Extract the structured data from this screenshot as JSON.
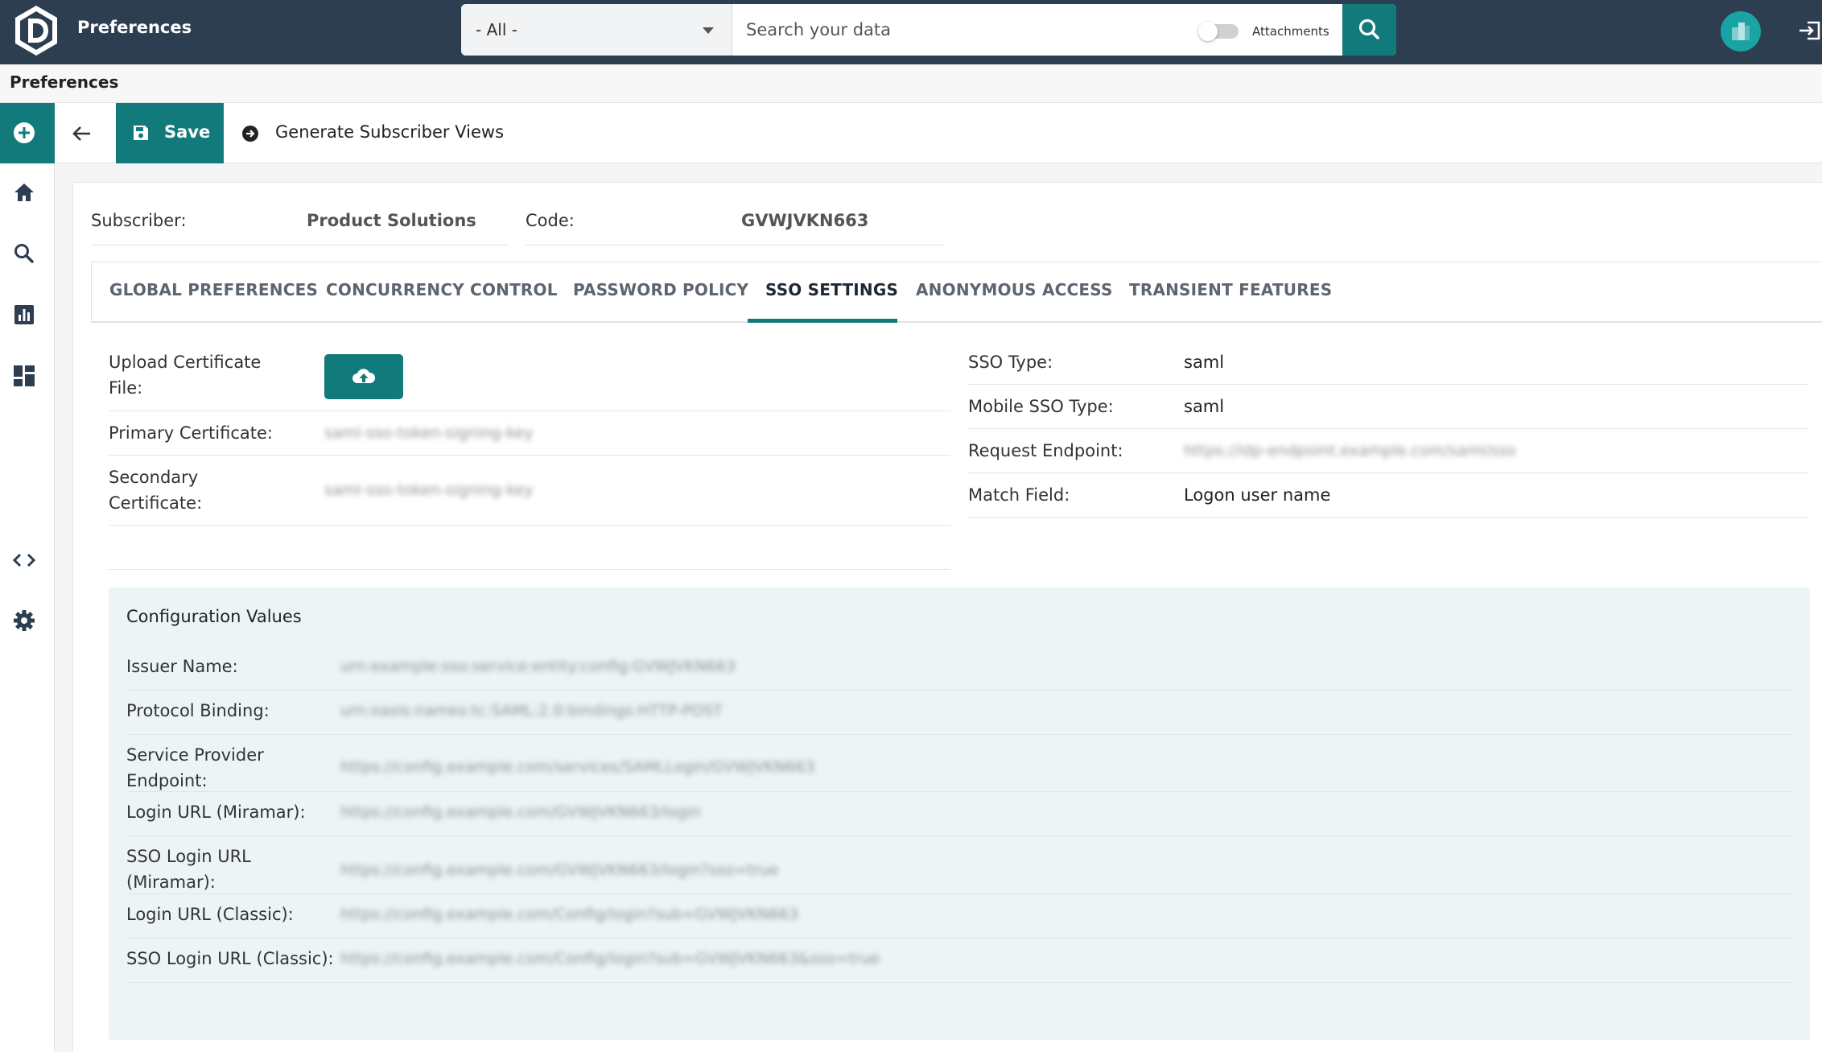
{
  "app": {
    "title": "Preferences"
  },
  "search": {
    "scope_value": "- All -",
    "placeholder": "Search your data",
    "attachments_label": "Attachments"
  },
  "breadcrumb": "Preferences",
  "toolbar": {
    "save_label": "Save",
    "generate_label": "Generate Subscriber Views"
  },
  "subscriber": {
    "label": "Subscriber:",
    "value": "Product Solutions",
    "code_label": "Code:",
    "code_value": "GVWJVKN663"
  },
  "tabs": [
    {
      "label": "GLOBAL PREFERENCES"
    },
    {
      "label": "CONCURRENCY CONTROL"
    },
    {
      "label": "PASSWORD POLICY"
    },
    {
      "label": "SSO SETTINGS",
      "active": true
    },
    {
      "label": "ANONYMOUS ACCESS"
    },
    {
      "label": "TRANSIENT FEATURES"
    }
  ],
  "sso_left": {
    "upload_label": "Upload Certificate File:",
    "primary_label": "Primary Certificate:",
    "primary_value": "saml-sso-token-signing-key",
    "secondary_label": "Secondary Certificate:",
    "secondary_value": "saml-sso-token-signing-key"
  },
  "sso_right": {
    "sso_type_label": "SSO Type:",
    "sso_type_value": "saml",
    "mobile_type_label": "Mobile SSO Type:",
    "mobile_type_value": "saml",
    "request_endpoint_label": "Request Endpoint:",
    "request_endpoint_value": "https://idp-endpoint.example.com/saml/sso",
    "match_field_label": "Match Field:",
    "match_field_value": "Logon user name"
  },
  "config": {
    "title": "Configuration Values",
    "rows": [
      {
        "label": "Issuer Name:",
        "value": "urn:example:sso:service:entity:config:GVWJVKN663"
      },
      {
        "label": "Protocol Binding:",
        "value": "urn:oasis:names:tc:SAML:2.0:bindings:HTTP-POST"
      },
      {
        "label": "Service Provider Endpoint:",
        "value": "https://config.example.com/services/SAMLLogin/GVWJVKN663"
      },
      {
        "label": "Login URL (Miramar):",
        "value": "https://config.example.com/GVWJVKN663/login"
      },
      {
        "label": "SSO Login URL (Miramar):",
        "value": "https://config.example.com/GVWJVKN663/login?sso=true"
      },
      {
        "label": "Login URL (Classic):",
        "value": "https://config.example.com/Config/login?sub=GVWJVKN663"
      },
      {
        "label": "SSO Login URL (Classic):",
        "value": "https://config.example.com/Config/login?sub=GVWJVKN663&sso=true"
      }
    ]
  },
  "icons": {
    "logo": "logo-d-icon",
    "search": "search-icon",
    "logout": "logout-icon",
    "add": "plus-circle-icon",
    "home": "home-icon",
    "rail_search": "search-icon",
    "reports": "bar-chart-icon",
    "dashboard": "dashboard-icon",
    "code": "code-icon",
    "settings": "gear-icon",
    "back": "arrow-left-icon",
    "save": "floppy-disk-icon",
    "generate": "arrow-right-circle-icon",
    "upload": "cloud-upload-icon"
  },
  "colors": {
    "header_bg": "#2c3e50",
    "accent": "#137a7c",
    "config_bg": "#edf4f6"
  }
}
